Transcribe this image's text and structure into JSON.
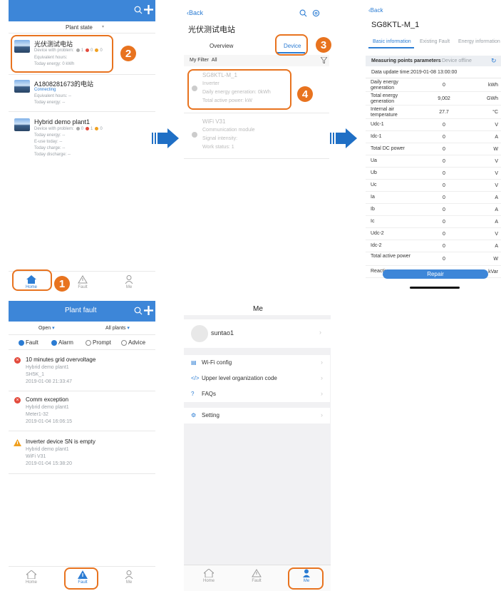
{
  "colors": {
    "accent": "#2b7cd3",
    "annotation": "#e8731f",
    "header_blue": "#3d86d8",
    "fault_red": "#e34b3d",
    "warn_orange": "#f0a020"
  },
  "plant_state": {
    "title": "Plant state",
    "plants": [
      {
        "name": "光伏测试电站",
        "lines": [
          {
            "label": "Device with problem:",
            "dots": [
              {
                "color": "#aaaaaa",
                "n": "1"
              },
              {
                "color": "#e34b3d",
                "n": "0"
              },
              {
                "color": "#f0a020",
                "n": "0"
              }
            ]
          },
          {
            "text": "Equivalent hours:"
          },
          {
            "text": "Today energy:  0 kWh"
          }
        ]
      },
      {
        "name": "A1808281673的电站",
        "lines": [
          {
            "text": "Connecting",
            "blue": true
          },
          {
            "text": "Equivalent hours:  --"
          },
          {
            "text": "Today energy:  --"
          }
        ]
      },
      {
        "name": "Hybrid demo plant1",
        "lines": [
          {
            "label": "Device with problem:",
            "dots": [
              {
                "color": "#aaaaaa",
                "n": "0"
              },
              {
                "color": "#e34b3d",
                "n": "1"
              },
              {
                "color": "#f0a020",
                "n": "0"
              }
            ]
          },
          {
            "text": "Today energy:  --"
          },
          {
            "text": "E-use today:  --"
          },
          {
            "text": "Today charge:  --"
          },
          {
            "text": "Today discharge:  --"
          }
        ]
      }
    ],
    "tabs": [
      "Home",
      "Fault",
      "Me"
    ]
  },
  "station": {
    "back": "Back",
    "title": "光伏测试电站",
    "tabs": [
      "Overview",
      "Device"
    ],
    "filter": "My Filter",
    "filter_value": "All",
    "devices": [
      {
        "name": "SG8KTL-M_1",
        "lines": [
          "Inverter",
          "Daily energy generation:  0kWh",
          "Total active power:  kW"
        ]
      },
      {
        "name": "WiFi V31",
        "lines": [
          "Communication module",
          "Signal intensity:",
          "Work status:  1"
        ]
      }
    ]
  },
  "device_detail": {
    "back": "Back",
    "title": "SG8KTL-M_1",
    "tabs": [
      "Basic information",
      "Existing Fault",
      "Energy information"
    ],
    "section": "Measuring points parameters",
    "status": "Device offline",
    "update": "Data update time:2019-01-08 13:00:00",
    "rows": [
      {
        "k": "Daily energy generation",
        "v": "0",
        "u": "kWh"
      },
      {
        "k": "Total energy generation",
        "v": "9,002",
        "u": "GWh"
      },
      {
        "k": "Internal air temperature",
        "v": "27.7",
        "u": "°C"
      },
      {
        "k": "Udc-1",
        "v": "0",
        "u": "V"
      },
      {
        "k": "Idc-1",
        "v": "0",
        "u": "A"
      },
      {
        "k": "Total DC power",
        "v": "0",
        "u": "W"
      },
      {
        "k": "Ua",
        "v": "0",
        "u": "V"
      },
      {
        "k": "Ub",
        "v": "0",
        "u": "V"
      },
      {
        "k": "Uc",
        "v": "0",
        "u": "V"
      },
      {
        "k": "Ia",
        "v": "0",
        "u": "A"
      },
      {
        "k": "Ib",
        "v": "0",
        "u": "A"
      },
      {
        "k": "Ic",
        "v": "0",
        "u": "A"
      },
      {
        "k": "Udc-2",
        "v": "0",
        "u": "V"
      },
      {
        "k": "Idc-2",
        "v": "0",
        "u": "A"
      },
      {
        "k": "Total active power",
        "v": "0",
        "u": "W"
      },
      {
        "k": "Reactive power",
        "v": "0",
        "u": "kVar"
      }
    ],
    "repair": "Repair"
  },
  "plant_fault": {
    "title": "Plant fault",
    "dropdowns": [
      "Open",
      "All plants"
    ],
    "filters": [
      {
        "label": "Fault",
        "checked": true
      },
      {
        "label": "Alarm",
        "checked": true
      },
      {
        "label": "Prompt",
        "checked": false
      },
      {
        "label": "Advice",
        "checked": false
      }
    ],
    "items": [
      {
        "type": "fault",
        "title": "10 minutes grid overvoltage",
        "lines": [
          "Hybrid demo plant1",
          "SH5K_1",
          "2019-01-08 21:33:47"
        ]
      },
      {
        "type": "fault",
        "title": "Comm exception",
        "lines": [
          "Hybrid demo plant1",
          "Meter1-32",
          "2019-01-04 16:06:15"
        ]
      },
      {
        "type": "warn",
        "title": "Inverter device SN is empty",
        "lines": [
          "Hybrid demo plant1",
          "WiFi V31",
          "2019-01-04 15:38:20"
        ]
      }
    ],
    "tabs": [
      "Home",
      "Fault",
      "Me"
    ]
  },
  "me": {
    "title": "Me",
    "user": "suntao1",
    "menu": [
      "Wi-Fi config",
      "Upper level organization code",
      "FAQs"
    ],
    "setting": "Setting",
    "tabs": [
      "Home",
      "Fault",
      "Me"
    ]
  },
  "steps": [
    "1",
    "2",
    "3",
    "4"
  ]
}
